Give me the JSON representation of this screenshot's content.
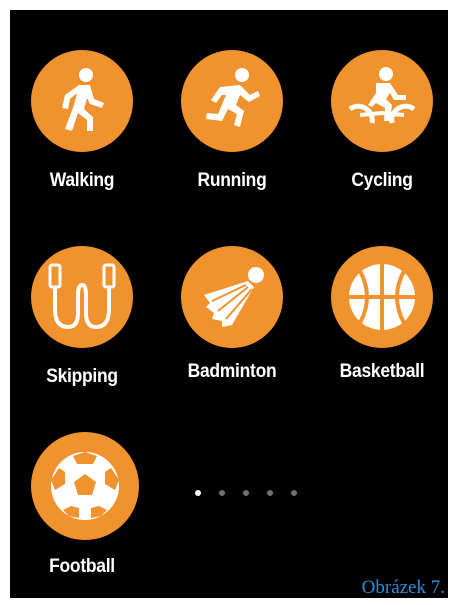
{
  "apps": [
    {
      "id": "walking",
      "label": "Walking",
      "icon": "walking-icon"
    },
    {
      "id": "running",
      "label": "Running",
      "icon": "running-icon"
    },
    {
      "id": "cycling",
      "label": "Cycling",
      "icon": "cycling-icon"
    },
    {
      "id": "skipping",
      "label": "Skipping",
      "icon": "jump-rope-icon"
    },
    {
      "id": "badminton",
      "label": "Badminton",
      "icon": "shuttlecock-icon"
    },
    {
      "id": "basketball",
      "label": "Basketball",
      "icon": "basketball-icon"
    },
    {
      "id": "football",
      "label": "Football",
      "icon": "soccer-ball-icon"
    }
  ],
  "pager": {
    "total_pages": 5,
    "current_page": 1
  },
  "caption": "Obrázek 7.",
  "colors": {
    "background": "#000000",
    "icon_circle": "#f0922e",
    "label": "#ffffff",
    "caption": "#2e8fd6"
  }
}
